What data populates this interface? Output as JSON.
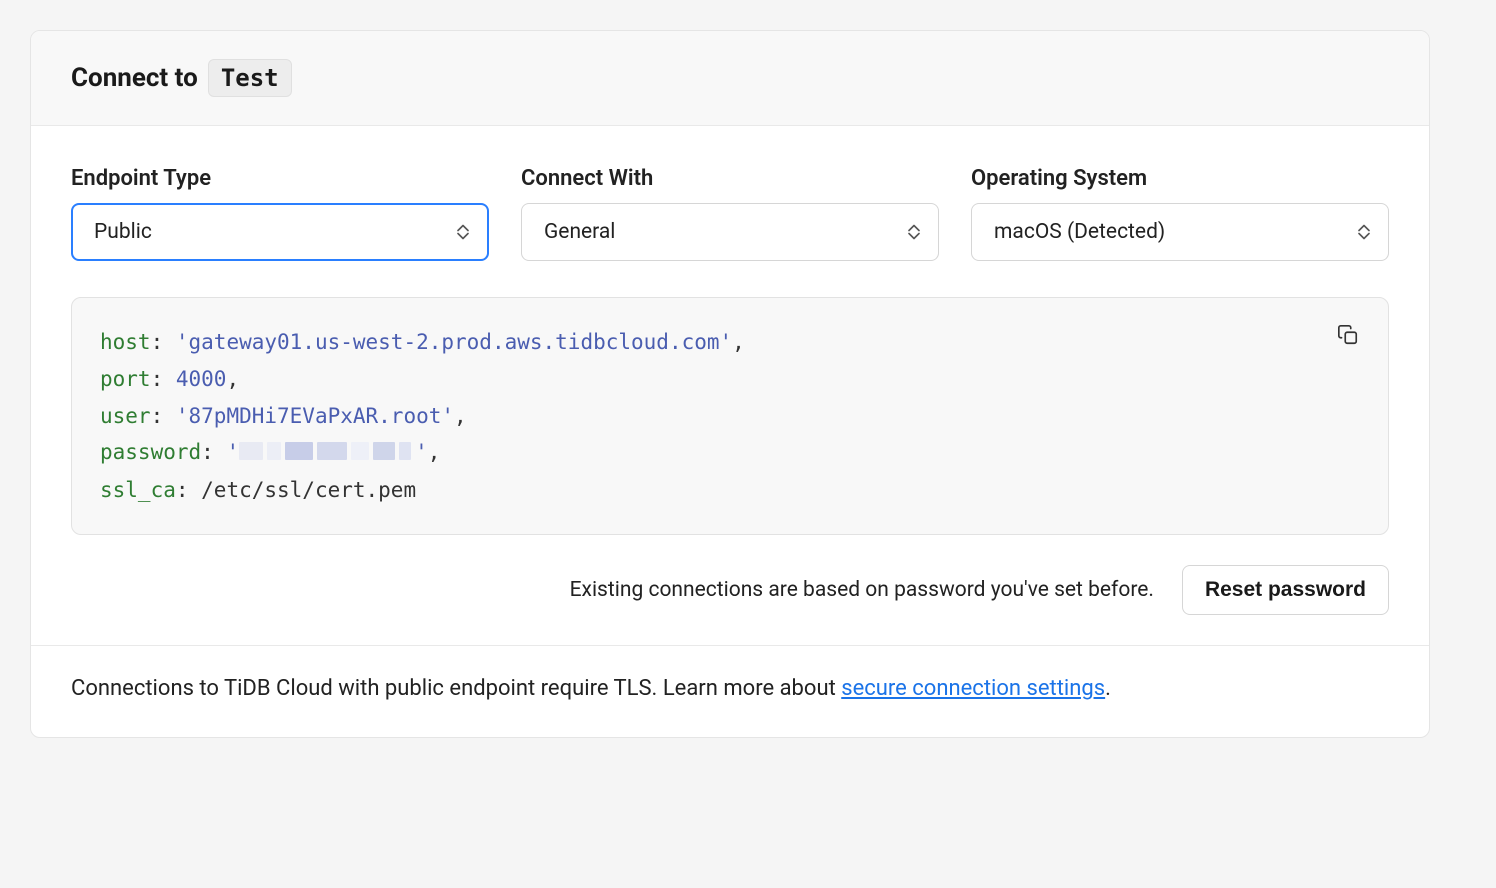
{
  "header": {
    "title_prefix": "Connect to",
    "cluster_name": "Test"
  },
  "fields": {
    "endpoint_type": {
      "label": "Endpoint Type",
      "value": "Public"
    },
    "connect_with": {
      "label": "Connect With",
      "value": "General"
    },
    "os": {
      "label": "Operating System",
      "value": "macOS (Detected)"
    }
  },
  "code": {
    "host_key": "host",
    "host_val": "'gateway01.us-west-2.prod.aws.tidbcloud.com'",
    "port_key": "port",
    "port_val": "4000",
    "user_key": "user",
    "user_val": "'87pMDHi7EVaPxAR.root'",
    "password_key": "password",
    "password_open": "'",
    "password_close": "'",
    "sslca_key": "ssl_ca",
    "sslca_val": "/etc/ssl/cert.pem",
    "sep": ": ",
    "comma": ","
  },
  "footer": {
    "note": "Existing connections are based on password you've set before.",
    "reset_label": "Reset password",
    "tls_text_prefix": "Connections to TiDB Cloud with public endpoint require TLS. Learn more about ",
    "tls_link_text": "secure connection settings",
    "period": "."
  },
  "icons": {
    "copy": "copy-icon",
    "caret": "updown-caret-icon"
  }
}
